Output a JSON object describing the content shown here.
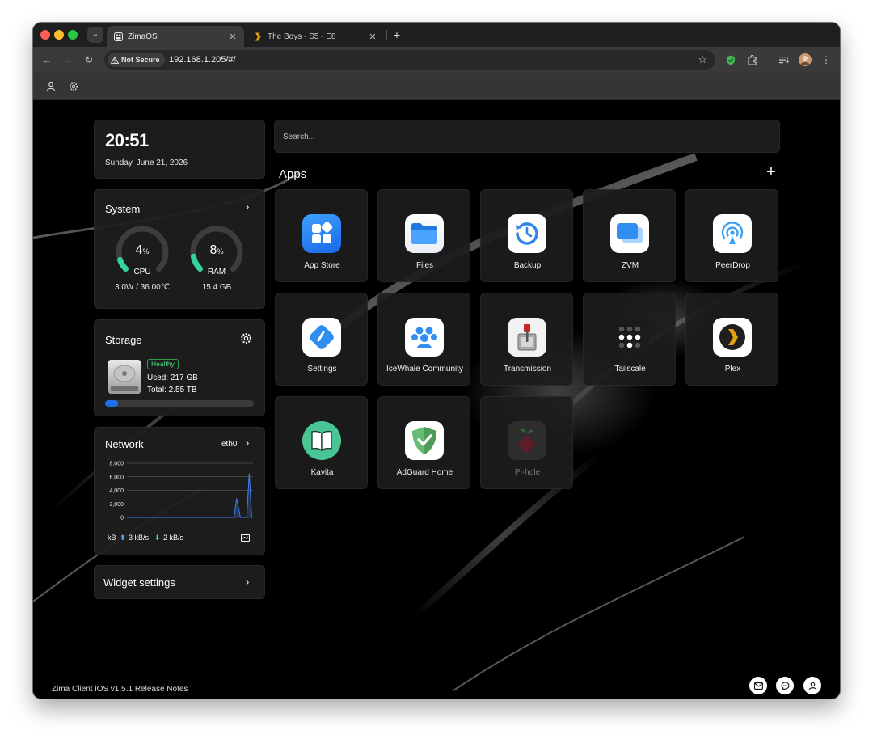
{
  "browser": {
    "tabs": [
      {
        "title": "ZimaOS",
        "close": "✕",
        "favicon": "zima-icon"
      },
      {
        "title": "The Boys - S5 - E8",
        "close": "✕",
        "favicon": "plex-chevron-icon"
      }
    ],
    "new_tab": "+",
    "security_label": "Not Secure",
    "url": "192.168.1.205/#/"
  },
  "widgets": {
    "clock": {
      "time": "20:51",
      "date": "Sunday, June 21, 2026"
    },
    "system": {
      "title": "System",
      "cpu": {
        "value": "4",
        "unit": "%",
        "label": "CPU",
        "sub": "3.0W / 36.00℃",
        "percent": 4
      },
      "ram": {
        "value": "8",
        "unit": "%",
        "label": "RAM",
        "sub": "15.4 GB",
        "percent": 8
      }
    },
    "storage": {
      "title": "Storage",
      "status": "Healthy",
      "used": "Used: 217 GB",
      "total": "Total: 2.55 TB",
      "used_fraction": 0.085
    },
    "network": {
      "title": "Network",
      "interface": "eth0",
      "unit": "kB",
      "upload": "3 kB/s",
      "download": "2 kB/s"
    },
    "widget_settings": {
      "title": "Widget settings"
    }
  },
  "chart_data": {
    "type": "line",
    "title": "",
    "y_ticks": [
      "8,000",
      "6,000",
      "4,000",
      "2,000",
      "0"
    ],
    "ylim": [
      0,
      8000
    ],
    "x": [
      0,
      10,
      20,
      30,
      40,
      50,
      60,
      70,
      80,
      85,
      87,
      90,
      95,
      97,
      99,
      100
    ],
    "values": [
      0,
      0,
      0,
      0,
      0,
      0,
      0,
      0,
      0,
      0,
      2800,
      0,
      0,
      6500,
      0,
      0
    ],
    "grid": true
  },
  "search": {
    "placeholder": "Search..."
  },
  "apps": {
    "title": "Apps",
    "add": "+",
    "items": [
      {
        "label": "App Store",
        "icon": "app-store-icon"
      },
      {
        "label": "Files",
        "icon": "files-icon"
      },
      {
        "label": "Backup",
        "icon": "backup-icon"
      },
      {
        "label": "ZVM",
        "icon": "zvm-icon"
      },
      {
        "label": "PeerDrop",
        "icon": "peerdrop-icon"
      },
      {
        "label": "Settings",
        "icon": "settings-app-icon"
      },
      {
        "label": "IceWhale Community",
        "icon": "icewhale-community-icon"
      },
      {
        "label": "Transmission",
        "icon": "transmission-icon"
      },
      {
        "label": "Tailscale",
        "icon": "tailscale-icon"
      },
      {
        "label": "Plex",
        "icon": "plex-icon"
      },
      {
        "label": "Kavita",
        "icon": "kavita-icon"
      },
      {
        "label": "AdGuard Home",
        "icon": "adguard-home-icon"
      },
      {
        "label": "Pi-hole",
        "icon": "pi-hole-icon"
      }
    ]
  },
  "footer": {
    "release_notes": "Zima Client iOS v1.5.1 Release Notes"
  }
}
